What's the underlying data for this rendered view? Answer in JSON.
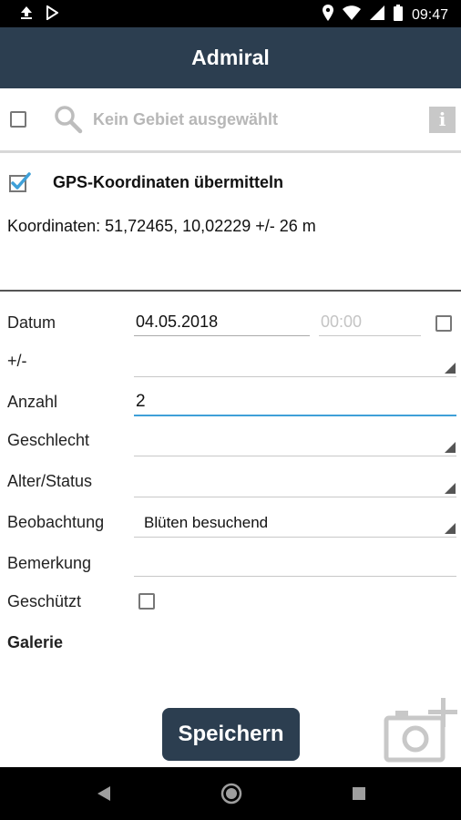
{
  "status_bar": {
    "time": "09:47"
  },
  "app_bar": {
    "title": "Admiral"
  },
  "search": {
    "placeholder": "Kein Gebiet ausgewählt",
    "info_label": "i"
  },
  "gps": {
    "checkbox_checked": true,
    "label": "GPS-Koordinaten übermitteln",
    "coordinates_text": "Koordinaten: 51,72465, 10,02229  +/- 26 m"
  },
  "form": {
    "datum": {
      "label": "Datum",
      "date": "04.05.2018",
      "time_placeholder": "00:00"
    },
    "plusminus": {
      "label": "+/-",
      "value": ""
    },
    "anzahl": {
      "label": "Anzahl",
      "value": "2"
    },
    "geschlecht": {
      "label": "Geschlecht",
      "value": ""
    },
    "alter_status": {
      "label": "Alter/Status",
      "value": ""
    },
    "beobachtung": {
      "label": "Beobachtung",
      "value": "Blüten besuchend"
    },
    "bemerkung": {
      "label": "Bemerkung",
      "value": ""
    },
    "geschuetzt": {
      "label": "Geschützt"
    },
    "galerie": {
      "label": "Galerie"
    }
  },
  "actions": {
    "save_label": "Speichern"
  },
  "colors": {
    "header": "#2c3e50",
    "accent": "#3fa0d8"
  }
}
